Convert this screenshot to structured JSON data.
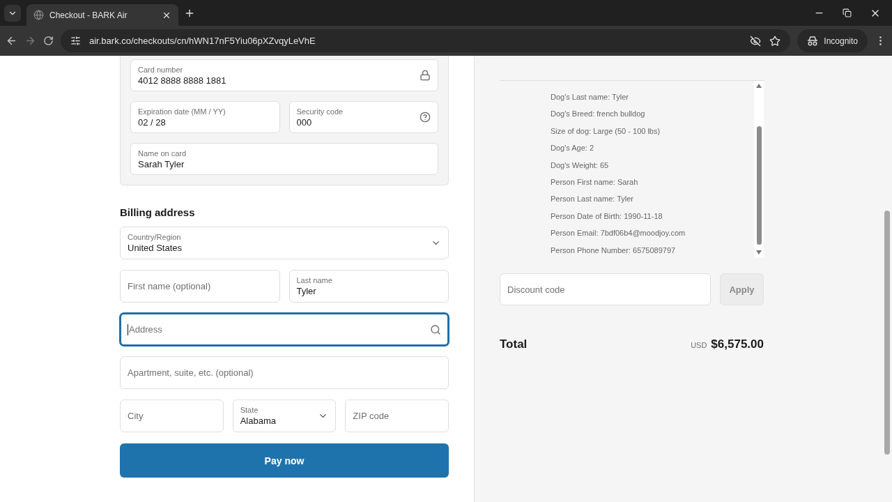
{
  "browser": {
    "tab_title": "Checkout - BARK Air",
    "url": "air.bark.co/checkouts/cn/hWN17nF5Yiu06pXZvqyLeVhE",
    "profile": "Incognito"
  },
  "card_fields": [
    [
      {
        "kind": "secure",
        "label": "Card number",
        "value": "4012 8888 8888 1881"
      }
    ],
    [
      {
        "kind": "text",
        "label": "Expiration date (MM / YY)",
        "value": "02 / 28"
      },
      {
        "kind": "help",
        "label": "Security code",
        "value": "000"
      }
    ],
    [
      {
        "kind": "text",
        "label": "Name on card",
        "value": "Sarah Tyler"
      }
    ]
  ],
  "billing": {
    "heading": "Billing address",
    "rows": [
      [
        {
          "kind": "select",
          "label": "Country/Region",
          "value": "United States"
        }
      ],
      [
        {
          "kind": "text",
          "placeholder": "First name (optional)"
        },
        {
          "kind": "text",
          "label": "Last name",
          "value": "Tyler"
        }
      ],
      [
        {
          "kind": "search",
          "placeholder": "Address",
          "focused": true
        }
      ],
      [
        {
          "kind": "text",
          "placeholder": "Apartment, suite, etc. (optional)"
        }
      ],
      [
        {
          "kind": "text",
          "placeholder": "City"
        },
        {
          "kind": "select",
          "label": "State",
          "value": "Alabama"
        },
        {
          "kind": "text",
          "placeholder": "ZIP code"
        }
      ]
    ]
  },
  "pay_button": "Pay now",
  "order_details": [
    "Dog's Last name: Tyler",
    "Dog's Breed: french bulldog",
    "Size of dog: Large (50 - 100 lbs)",
    "Dog's Age: 2",
    "Dog's Weight: 65",
    "Person First name: Sarah",
    "Person Last name: Tyler",
    "Person Date of Birth: 1990-11-18",
    "Person Email: 7bdf06b4@moodjoy.com",
    "Person Phone Number: 6575089797"
  ],
  "discount": {
    "placeholder": "Discount code",
    "button": "Apply",
    "disabled": true
  },
  "total": {
    "label": "Total",
    "currency": "USD",
    "amount": "$6,575.00"
  }
}
